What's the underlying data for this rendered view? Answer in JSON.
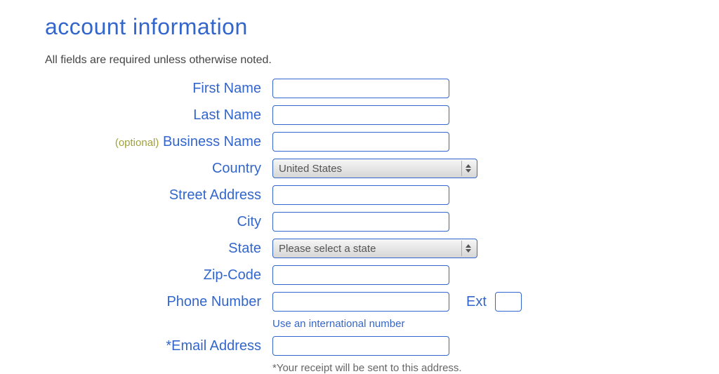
{
  "heading": "account information",
  "required_note": "All fields are required unless otherwise noted.",
  "labels": {
    "first_name": "First Name",
    "last_name": "Last Name",
    "optional_prefix": "(optional)",
    "business_name": "Business Name",
    "country": "Country",
    "street_address": "Street Address",
    "city": "City",
    "state": "State",
    "zip_code": "Zip-Code",
    "phone_number": "Phone Number",
    "ext": "Ext",
    "email_address": "*Email Address"
  },
  "selects": {
    "country": "United States",
    "state": "Please select a state"
  },
  "helpers": {
    "intl_link": "Use an international number",
    "email_note": "*Your receipt will be sent to this address."
  }
}
